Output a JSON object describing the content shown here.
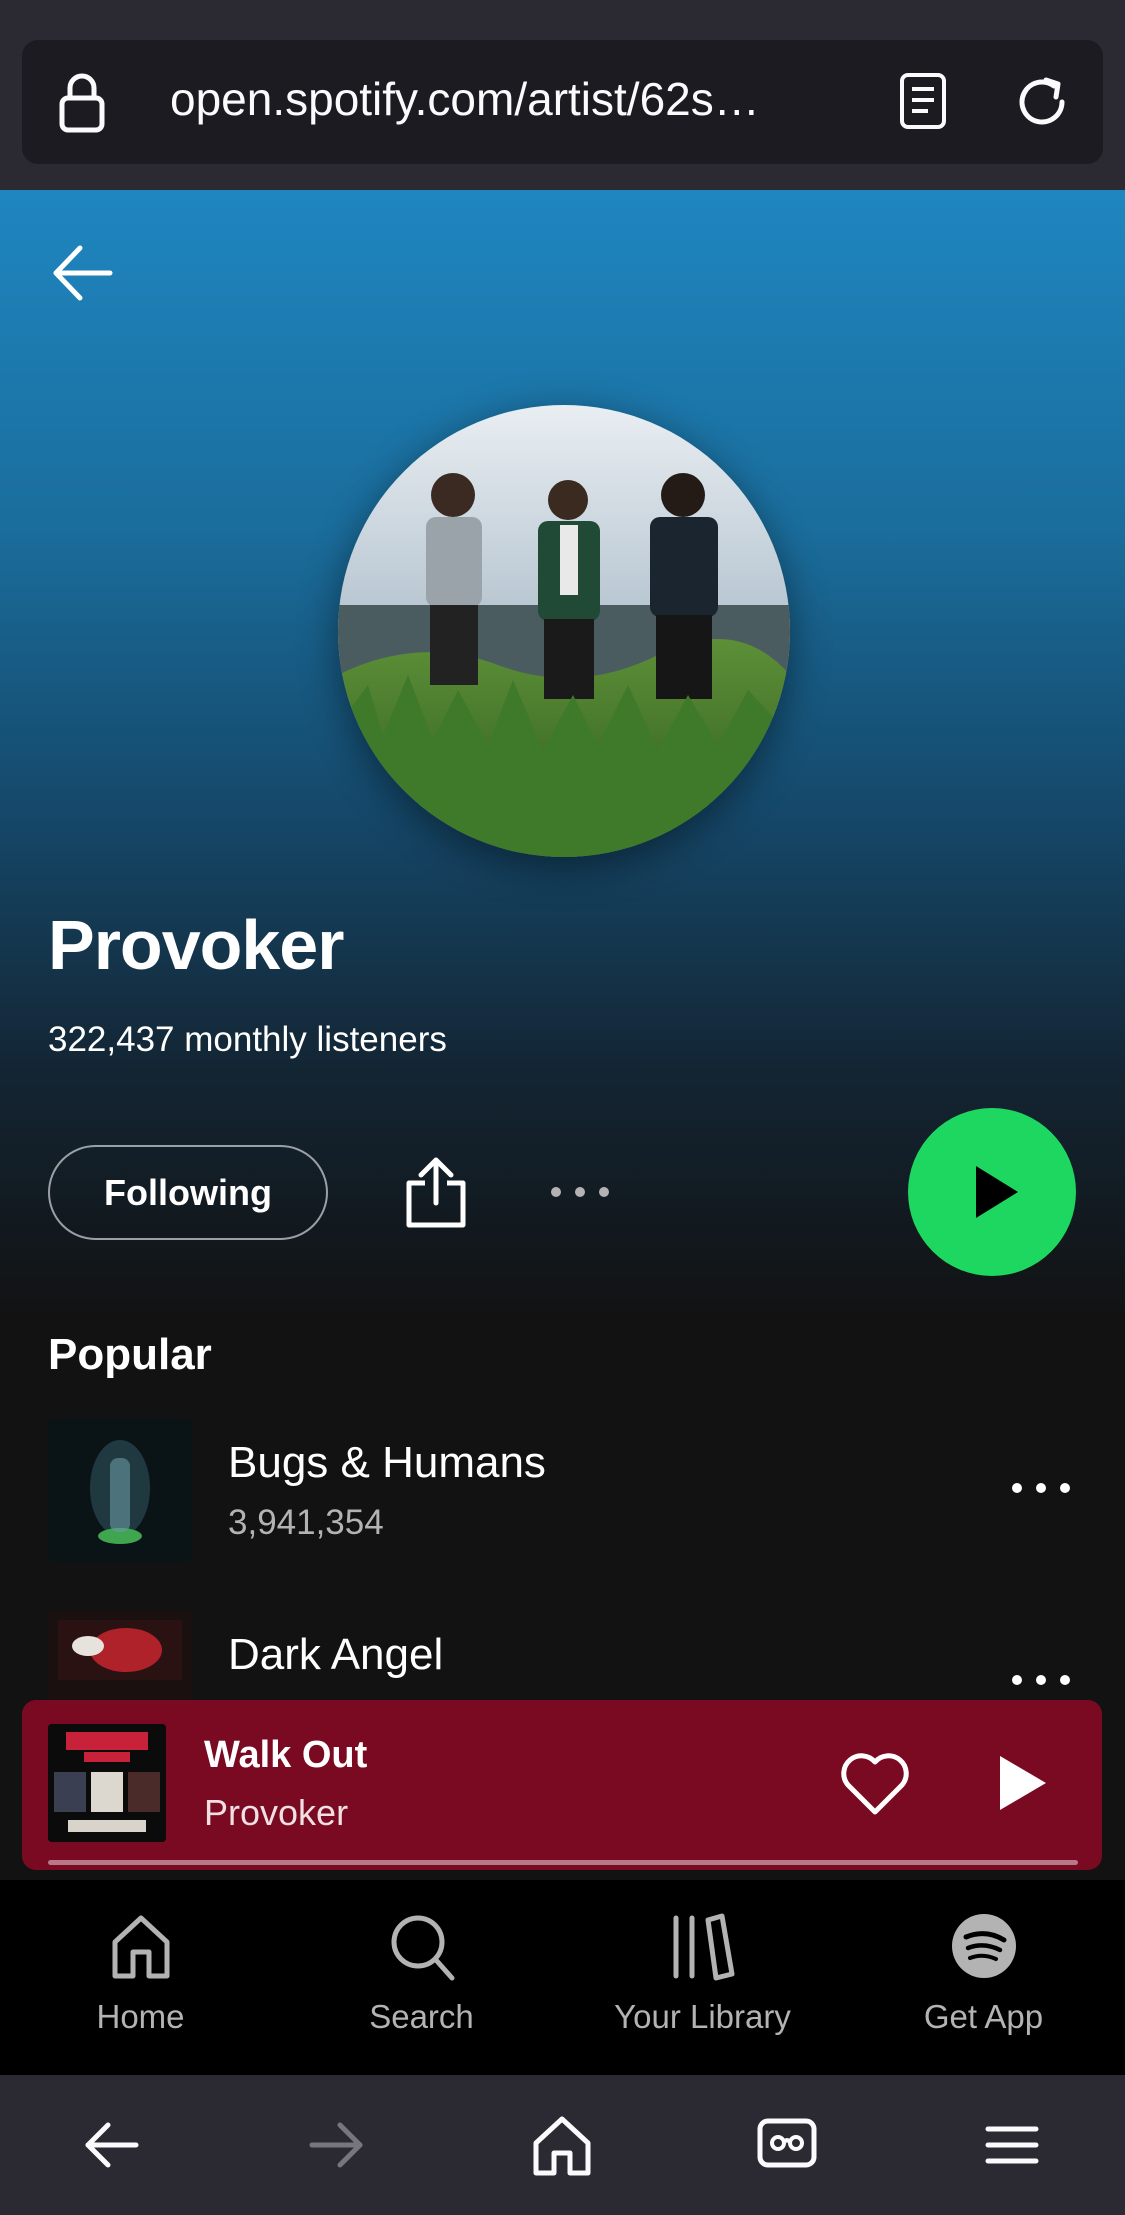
{
  "browser": {
    "url": "open.spotify.com/artist/62s…",
    "colors": {
      "chrome": "#2b2a33",
      "urlbar": "#1c1b22"
    },
    "icons": [
      "lock-icon",
      "reader-mode-icon",
      "reload-icon"
    ]
  },
  "artist": {
    "name": "Provoker",
    "monthly_listeners": "322,437 monthly listeners",
    "follow_label": "Following"
  },
  "popular": {
    "title": "Popular",
    "tracks": [
      {
        "name": "Bugs & Humans",
        "plays": "3,941,354"
      },
      {
        "name": "Dark Angel",
        "plays": ""
      }
    ]
  },
  "now_playing": {
    "title": "Walk Out",
    "artist": "Provoker",
    "progress_fraction": 0.0,
    "colors": {
      "background": "#7a0a21"
    }
  },
  "nav": {
    "items": [
      {
        "label": "Home",
        "icon": "home-icon"
      },
      {
        "label": "Search",
        "icon": "search-icon"
      },
      {
        "label": "Your Library",
        "icon": "library-icon"
      },
      {
        "label": "Get App",
        "icon": "spotify-logo-icon"
      }
    ]
  },
  "colors": {
    "accent": "#1ed760",
    "hero_top": "#1f86c0",
    "background": "#121212"
  }
}
